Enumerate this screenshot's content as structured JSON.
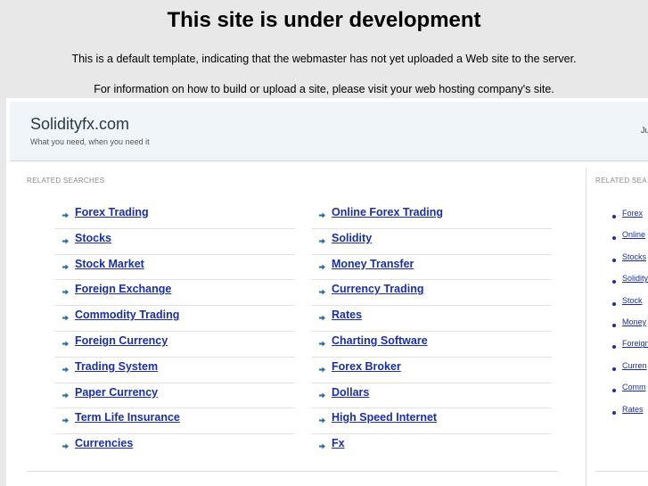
{
  "banner": {
    "title": "This site is under development",
    "line1": "This is a default template, indicating that the webmaster has not yet uploaded a Web site to the server.",
    "line2": "For information on how to build or upload a site, please visit your web hosting company's site."
  },
  "header": {
    "site_title": "Solidityfx.com",
    "tagline": "What you need, when you need it",
    "right_text": "Ju"
  },
  "main": {
    "section_label": "RELATED SEARCHES",
    "left_links": [
      "Forex Trading",
      "Stocks",
      "Stock Market",
      "Foreign Exchange",
      "Commodity Trading",
      "Foreign Currency",
      "Trading System",
      "Paper Currency",
      "Term Life Insurance",
      "Currencies"
    ],
    "right_links": [
      "Online Forex Trading",
      "Solidity",
      "Money Transfer",
      "Currency Trading",
      "Rates",
      "Charting Software",
      "Forex Broker",
      "Dollars",
      "High Speed Internet",
      "Fx"
    ]
  },
  "side": {
    "section_label": "RELATED SEA",
    "links": [
      "Forex",
      "Online",
      "Stocks",
      "Solidity",
      "Stock",
      "Money",
      "Foreign",
      "Curren",
      "Comm",
      "Rates"
    ]
  },
  "colors": {
    "link": "#1a2fa0",
    "arrow": "#2a6a9a",
    "page_bg": "#e8e8e8",
    "header_bg": "#f0f5f9"
  }
}
